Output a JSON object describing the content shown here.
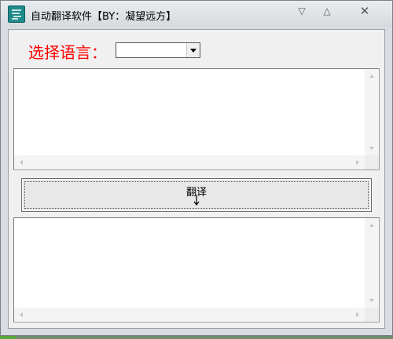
{
  "window": {
    "title": "自动翻译软件【BY：凝望远方】",
    "controls": {
      "minimize": "▽",
      "maximize": "△",
      "close": "✕"
    }
  },
  "language": {
    "label": "选择语言：",
    "selected": "",
    "label_color": "#ff0000"
  },
  "input_box": {
    "text": ""
  },
  "translate_button": {
    "label": "翻译"
  },
  "output_box": {
    "text": ""
  },
  "icons": [
    "app-icon",
    "minimize-icon",
    "maximize-icon",
    "close-icon",
    "dropdown-arrow-icon",
    "scroll-up-icon",
    "scroll-down-icon",
    "scroll-left-icon",
    "scroll-right-icon",
    "text-cursor-icon"
  ]
}
